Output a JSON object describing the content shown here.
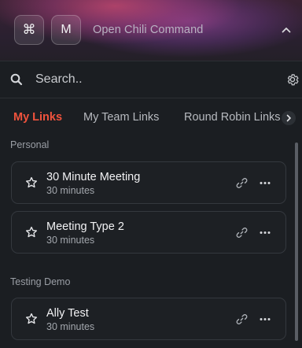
{
  "header": {
    "key1_label": "⌘",
    "key2_label": "M",
    "title": "Open Chili Command"
  },
  "search": {
    "placeholder": "Search..",
    "value": ""
  },
  "tabs": [
    {
      "label": "My Links",
      "active": true
    },
    {
      "label": "My Team Links",
      "active": false
    },
    {
      "label": "Round Robin Links",
      "active": false
    }
  ],
  "sections": [
    {
      "label": "Personal",
      "items": [
        {
          "title": "30 Minute Meeting",
          "duration": "30 minutes"
        },
        {
          "title": "Meeting Type 2",
          "duration": "30 minutes"
        }
      ]
    },
    {
      "label": "Testing Demo",
      "items": [
        {
          "title": "Ally Test",
          "duration": "30 minutes"
        }
      ]
    }
  ],
  "colors": {
    "accent": "#f0533d",
    "background": "#1b1e22",
    "card_border": "#34383e"
  },
  "icons": {
    "search": "search-icon",
    "settings": "gear-icon",
    "collapse": "chevron-up-icon",
    "tab_next": "chevron-right-icon",
    "favorite": "star-icon",
    "copy_link": "link-icon",
    "more": "more-horizontal-icon"
  }
}
